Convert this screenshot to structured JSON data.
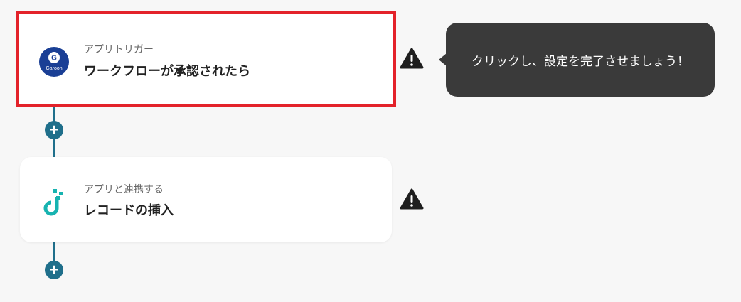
{
  "steps": [
    {
      "subtitle": "アプリトリガー",
      "title": "ワークフローが承認されたら",
      "app_icon": "garoon-icon",
      "app_icon_text_top": "G",
      "app_icon_text_bottom": "Garoon",
      "warning_icon": "warning-icon",
      "selected": true
    },
    {
      "subtitle": "アプリと連携する",
      "title": "レコードの挿入",
      "app_icon": "database-app-icon",
      "warning_icon": "warning-icon",
      "selected": false
    }
  ],
  "tooltip": {
    "text": "クリックし、設定を完了させましょう！"
  },
  "add_button": {
    "symbol": "+"
  },
  "colors": {
    "background": "#f7f7f7",
    "connector": "#1f6f8b",
    "selected_border": "#e3222a",
    "tooltip_bg": "#3a3a3a",
    "garoon_blue": "#1a3f95",
    "accent_teal": "#17b3b0"
  }
}
